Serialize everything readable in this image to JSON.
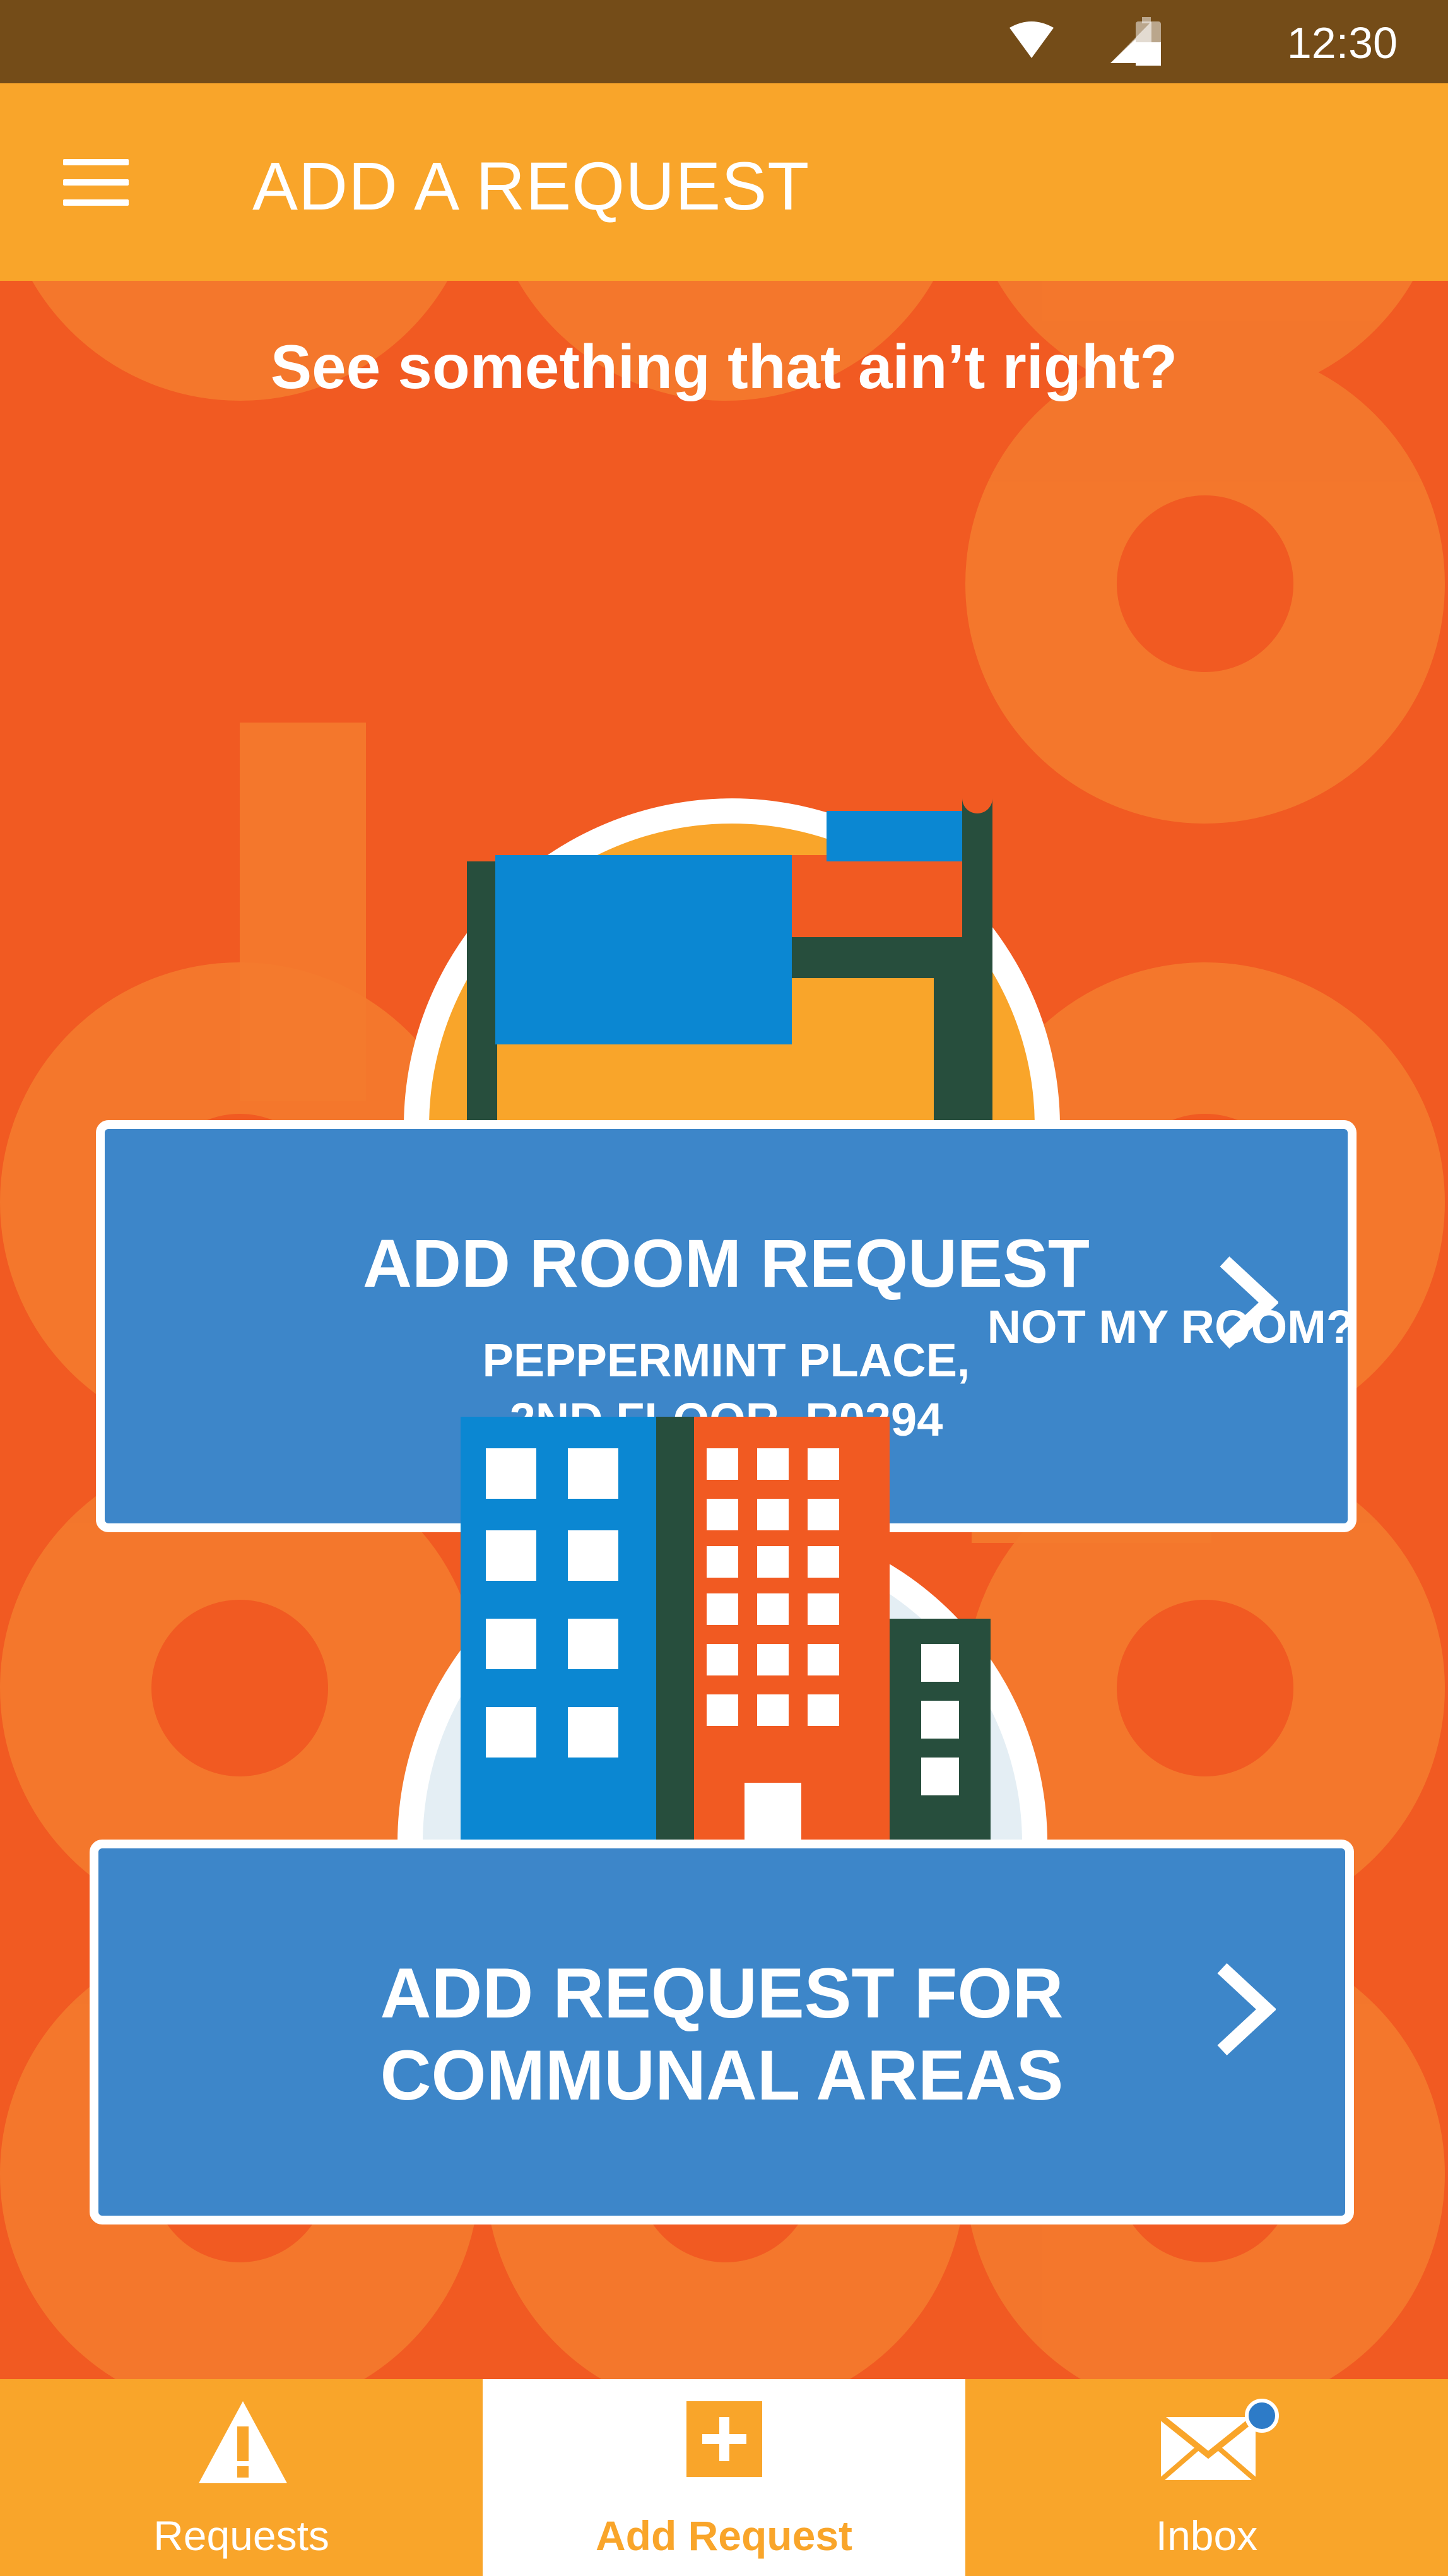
{
  "status_bar": {
    "time": "12:30",
    "icons": [
      "wifi-icon",
      "signal-icon",
      "battery-icon"
    ]
  },
  "app_bar": {
    "title": "ADD A REQUEST",
    "menu_icon": "hamburger-menu-icon"
  },
  "main": {
    "tagline": "See something that ain’t right?",
    "room_request": {
      "title": "ADD ROOM REQUEST",
      "location_line1": "PEPPERMINT PLACE,",
      "location_line2": "2ND FLOOR, R0294",
      "icon": "chevron-right-icon"
    },
    "not_my_room": "NOT MY ROOM?",
    "communal_request": {
      "title_line1": "ADD REQUEST FOR",
      "title_line2": "COMMUNAL AREAS",
      "icon": "chevron-right-icon"
    }
  },
  "bottom_nav": {
    "items": [
      {
        "label": "Requests",
        "icon": "warning-icon",
        "active": false
      },
      {
        "label": "Add Request",
        "icon": "plus-icon",
        "active": true
      },
      {
        "label": "Inbox",
        "icon": "mail-icon",
        "active": false,
        "badge": true
      }
    ]
  },
  "colors": {
    "status_bar": "#744C18",
    "app_bar": "#F9A52A",
    "background": "#F15A22",
    "card": "#3D86C9",
    "active_nav_text": "#F9A52A"
  }
}
